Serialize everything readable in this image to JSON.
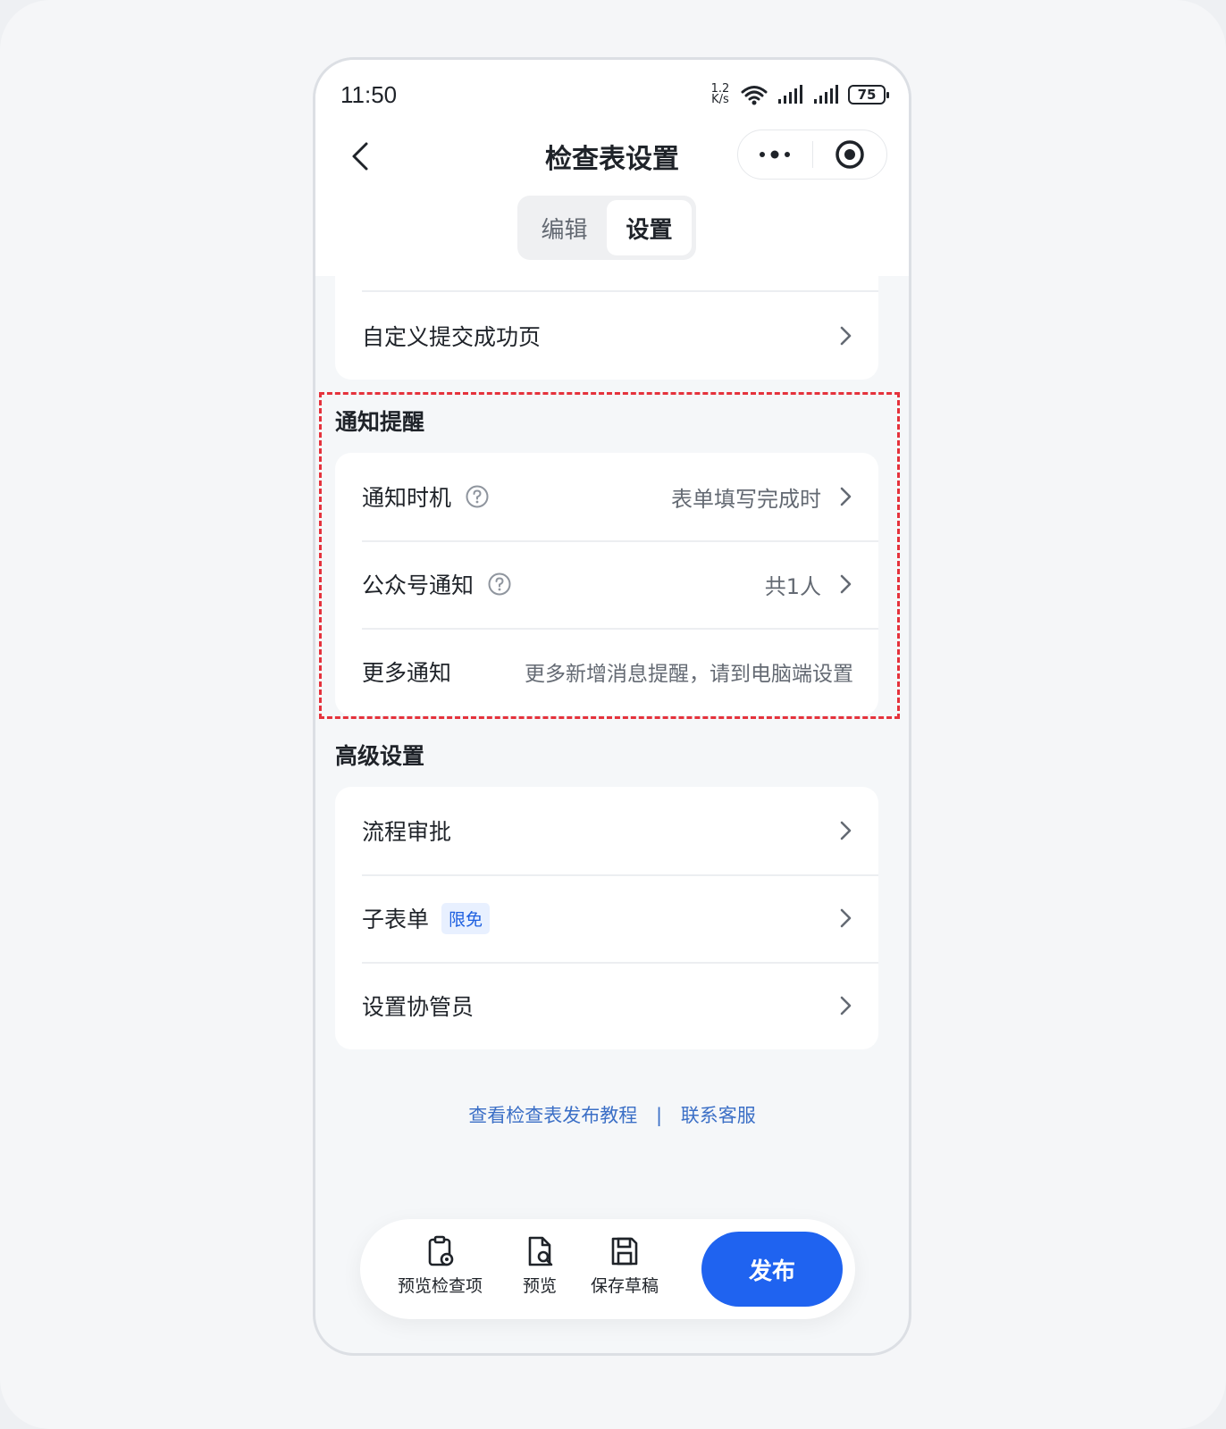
{
  "status": {
    "time": "11:50",
    "speed_top": "1.2",
    "speed_bottom": "K/s",
    "battery": "75"
  },
  "nav": {
    "title": "检查表设置"
  },
  "tabs": [
    {
      "label": "编辑"
    },
    {
      "label": "设置"
    }
  ],
  "card_top": {
    "item": "自定义提交成功页"
  },
  "notify": {
    "title": "通知提醒",
    "items": [
      {
        "label": "通知时机",
        "value": "表单填写完成时"
      },
      {
        "label": "公众号通知",
        "value": "共1人"
      },
      {
        "label": "更多通知",
        "value": "更多新增消息提醒，请到电脑端设置"
      }
    ]
  },
  "advanced": {
    "title": "高级设置",
    "items": [
      {
        "label": "流程审批"
      },
      {
        "label": "子表单",
        "tag": "限免"
      },
      {
        "label": "设置协管员"
      }
    ]
  },
  "footer": {
    "tutorial": "查看检查表发布教程",
    "separator": "|",
    "service": "联系客服"
  },
  "bottom": {
    "preview_items": "预览检查项",
    "preview": "预览",
    "save_draft": "保存草稿",
    "publish": "发布"
  },
  "colors": {
    "accent": "#1f63f0",
    "highlight": "#e5323c",
    "link": "#3b6fc6",
    "tag_text": "#1d5fe0"
  }
}
